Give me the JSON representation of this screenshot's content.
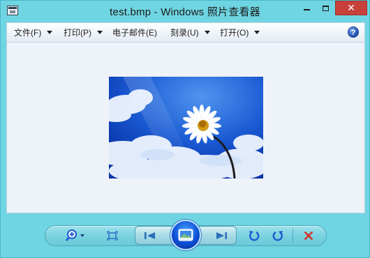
{
  "window": {
    "title": "test.bmp - Windows 照片查看器",
    "minimize_icon": "minimize-icon",
    "maximize_icon": "maximize-icon",
    "close_label": "✕"
  },
  "menu": {
    "items": [
      {
        "label": "文件(F)",
        "has_arrow": true
      },
      {
        "label": "打印(P)",
        "has_arrow": true
      },
      {
        "label": "电子邮件(E)",
        "has_arrow": false
      },
      {
        "label": "刻录(U)",
        "has_arrow": true
      },
      {
        "label": "打开(O)",
        "has_arrow": true
      }
    ],
    "help_label": "?"
  },
  "image": {
    "description_icon": "daisy-photo"
  },
  "toolbar": {
    "icons": [
      "zoom-icon",
      "actual-size-icon",
      "previous-icon",
      "slideshow-icon",
      "next-icon",
      "rotate-ccw-icon",
      "rotate-cw-icon",
      "delete-icon"
    ]
  },
  "colors": {
    "chrome": "#6fd5e2",
    "close_button": "#c7403a",
    "content_bg": "#eef2f9",
    "accent_blue": "#1f5fd1",
    "delete_red": "#d9302a"
  }
}
